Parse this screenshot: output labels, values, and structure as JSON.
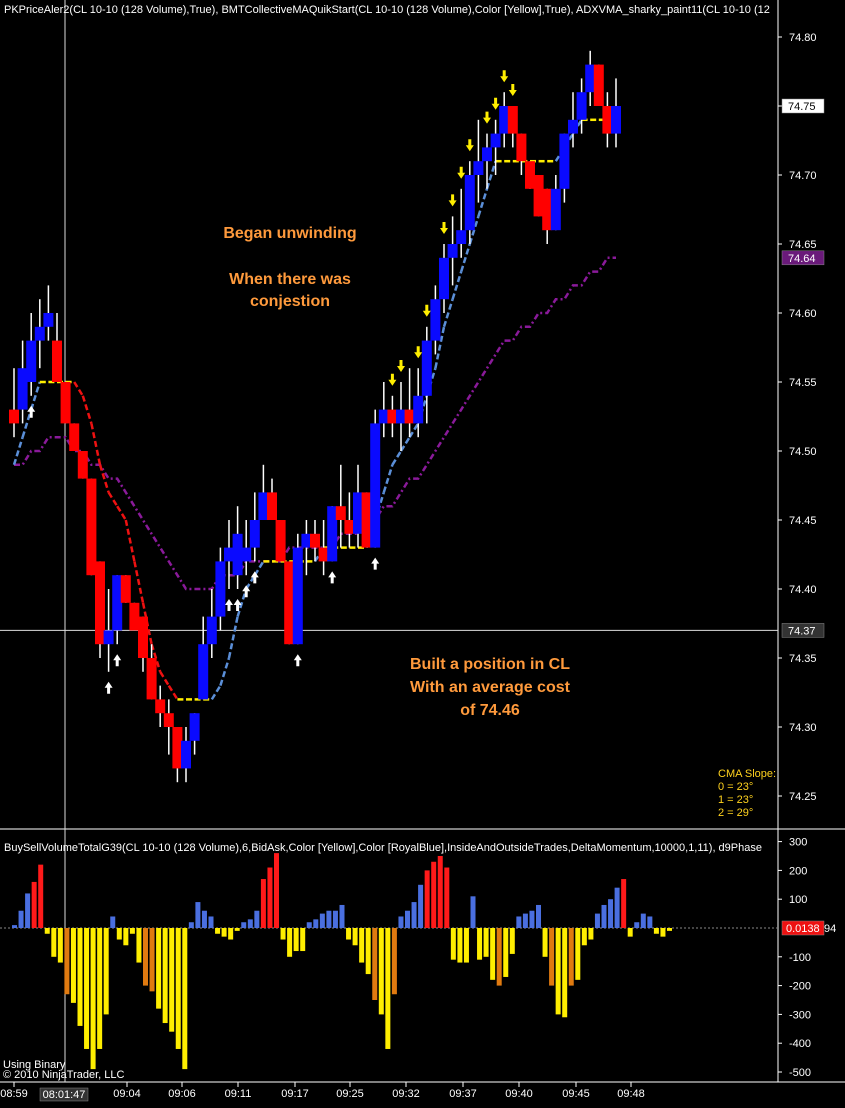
{
  "header": {
    "price_indicators": "PKPriceAler2(CL 10-10 (128 Volume),True), BMTCollectiveMAQuikStart(CL 10-10 (128 Volume),Color [Yellow],True), ADXVMA_sharky_paint11(CL 10-10 (12",
    "volume_indicators": "BuySellVolumeTotalG39(CL 10-10 (128 Volume),6,BidAsk,Color [Yellow],Color [RoyalBlue],InsideAndOutsideTrades,DeltaMomentum,10000,1,11), d9Phase"
  },
  "annotations": {
    "unwind_1": "Began unwinding",
    "unwind_2": "When there was",
    "unwind_3": "conjestion",
    "position_1": "Built a position in CL",
    "position_2": "With an average cost",
    "position_3": "of 74.46"
  },
  "cma_slope": {
    "title": "CMA Slope:",
    "line_0": "0 = 23°",
    "line_1": "1 = 23°",
    "line_2": "2 = 29°"
  },
  "footer": {
    "line1": "Using Binary",
    "line2": "© 2010 NinjaTrader, LLC"
  },
  "colors": {
    "up_bar": "#0a0aff",
    "down_bar": "#ff0000",
    "buy_volume": "#4a6fe0",
    "sell_volume": "#ffee00",
    "buy_volume_strong": "#ff1a1a",
    "sell_volume_strong": "#e07a10",
    "ma_fast": "#5b8fd8",
    "ma_slow": "#8a1a9a",
    "annotation": "#ff9a3c",
    "cma_label": "#ffd21e"
  },
  "chart_data": [
    {
      "type": "candlestick",
      "title": "",
      "price_axis": {
        "ticks": [
          "74.80",
          "74.75",
          "74.70",
          "74.65",
          "74.60",
          "74.55",
          "74.50",
          "74.45",
          "74.40",
          "74.35",
          "74.30",
          "74.25"
        ],
        "ylim": [
          74.22,
          74.82
        ]
      },
      "price_markers": {
        "last": "74.75",
        "ma": "74.64",
        "crosshair": "74.37"
      },
      "time_axis": {
        "ticks": [
          "08:59",
          "09:04",
          "09:06",
          "09:11",
          "09:17",
          "09:25",
          "09:32",
          "09:37",
          "09:40",
          "09:45",
          "09:48"
        ],
        "cursor_time": "08:01:47"
      },
      "candles": [
        {
          "o": 74.53,
          "h": 74.56,
          "l": 74.51,
          "c": 74.52
        },
        {
          "o": 74.53,
          "h": 74.58,
          "l": 74.52,
          "c": 74.56
        },
        {
          "o": 74.55,
          "h": 74.6,
          "l": 74.54,
          "c": 74.58
        },
        {
          "o": 74.58,
          "h": 74.61,
          "l": 74.56,
          "c": 74.59
        },
        {
          "o": 74.59,
          "h": 74.62,
          "l": 74.58,
          "c": 74.6
        },
        {
          "o": 74.58,
          "h": 74.6,
          "l": 74.55,
          "c": 74.55
        },
        {
          "o": 74.55,
          "h": 74.55,
          "l": 74.52,
          "c": 74.52
        },
        {
          "o": 74.52,
          "h": 74.52,
          "l": 74.5,
          "c": 74.5
        },
        {
          "o": 74.5,
          "h": 74.5,
          "l": 74.48,
          "c": 74.48
        },
        {
          "o": 74.48,
          "h": 74.48,
          "l": 74.41,
          "c": 74.41
        },
        {
          "o": 74.42,
          "h": 74.42,
          "l": 74.35,
          "c": 74.36
        },
        {
          "o": 74.36,
          "h": 74.4,
          "l": 74.34,
          "c": 74.37
        },
        {
          "o": 74.37,
          "h": 74.41,
          "l": 74.36,
          "c": 74.41
        },
        {
          "o": 74.41,
          "h": 74.41,
          "l": 74.39,
          "c": 74.39
        },
        {
          "o": 74.39,
          "h": 74.39,
          "l": 74.37,
          "c": 74.37
        },
        {
          "o": 74.38,
          "h": 74.38,
          "l": 74.34,
          "c": 74.35
        },
        {
          "o": 74.35,
          "h": 74.36,
          "l": 74.32,
          "c": 74.32
        },
        {
          "o": 74.32,
          "h": 74.33,
          "l": 74.3,
          "c": 74.31
        },
        {
          "o": 74.31,
          "h": 74.32,
          "l": 74.28,
          "c": 74.3
        },
        {
          "o": 74.3,
          "h": 74.3,
          "l": 74.26,
          "c": 74.27
        },
        {
          "o": 74.27,
          "h": 74.3,
          "l": 74.26,
          "c": 74.29
        },
        {
          "o": 74.29,
          "h": 74.31,
          "l": 74.28,
          "c": 74.31
        },
        {
          "o": 74.32,
          "h": 74.38,
          "l": 74.32,
          "c": 74.36
        },
        {
          "o": 74.36,
          "h": 74.4,
          "l": 74.35,
          "c": 74.38
        },
        {
          "o": 74.38,
          "h": 74.43,
          "l": 74.37,
          "c": 74.42
        },
        {
          "o": 74.42,
          "h": 74.45,
          "l": 74.4,
          "c": 74.43
        },
        {
          "o": 74.41,
          "h": 74.46,
          "l": 74.4,
          "c": 74.44
        },
        {
          "o": 74.42,
          "h": 74.45,
          "l": 74.41,
          "c": 74.43
        },
        {
          "o": 74.43,
          "h": 74.47,
          "l": 74.42,
          "c": 74.45
        },
        {
          "o": 74.45,
          "h": 74.49,
          "l": 74.45,
          "c": 74.47
        },
        {
          "o": 74.47,
          "h": 74.48,
          "l": 74.45,
          "c": 74.45
        },
        {
          "o": 74.45,
          "h": 74.45,
          "l": 74.42,
          "c": 74.42
        },
        {
          "o": 74.42,
          "h": 74.42,
          "l": 74.36,
          "c": 74.36
        },
        {
          "o": 74.36,
          "h": 74.44,
          "l": 74.36,
          "c": 74.43
        },
        {
          "o": 74.43,
          "h": 74.45,
          "l": 74.41,
          "c": 74.44
        },
        {
          "o": 74.44,
          "h": 74.45,
          "l": 74.42,
          "c": 74.43
        },
        {
          "o": 74.43,
          "h": 74.45,
          "l": 74.41,
          "c": 74.42
        },
        {
          "o": 74.42,
          "h": 74.46,
          "l": 74.42,
          "c": 74.46
        },
        {
          "o": 74.46,
          "h": 74.49,
          "l": 74.43,
          "c": 74.45
        },
        {
          "o": 74.45,
          "h": 74.47,
          "l": 74.43,
          "c": 74.44
        },
        {
          "o": 74.44,
          "h": 74.49,
          "l": 74.43,
          "c": 74.47
        },
        {
          "o": 74.47,
          "h": 74.47,
          "l": 74.43,
          "c": 74.43
        },
        {
          "o": 74.43,
          "h": 74.53,
          "l": 74.43,
          "c": 74.52
        },
        {
          "o": 74.52,
          "h": 74.55,
          "l": 74.51,
          "c": 74.53
        },
        {
          "o": 74.53,
          "h": 74.54,
          "l": 74.51,
          "c": 74.52
        },
        {
          "o": 74.52,
          "h": 74.55,
          "l": 74.5,
          "c": 74.53
        },
        {
          "o": 74.53,
          "h": 74.56,
          "l": 74.51,
          "c": 74.52
        },
        {
          "o": 74.52,
          "h": 74.56,
          "l": 74.51,
          "c": 74.54
        },
        {
          "o": 74.54,
          "h": 74.59,
          "l": 74.52,
          "c": 74.58
        },
        {
          "o": 74.58,
          "h": 74.62,
          "l": 74.57,
          "c": 74.61
        },
        {
          "o": 74.61,
          "h": 74.65,
          "l": 74.6,
          "c": 74.64
        },
        {
          "o": 74.64,
          "h": 74.67,
          "l": 74.62,
          "c": 74.65
        },
        {
          "o": 74.65,
          "h": 74.69,
          "l": 74.64,
          "c": 74.66
        },
        {
          "o": 74.66,
          "h": 74.71,
          "l": 74.65,
          "c": 74.7
        },
        {
          "o": 74.7,
          "h": 74.74,
          "l": 74.68,
          "c": 74.71
        },
        {
          "o": 74.71,
          "h": 74.73,
          "l": 74.69,
          "c": 74.72
        },
        {
          "o": 74.72,
          "h": 74.74,
          "l": 74.7,
          "c": 74.73
        },
        {
          "o": 74.73,
          "h": 74.76,
          "l": 74.72,
          "c": 74.75
        },
        {
          "o": 74.75,
          "h": 74.75,
          "l": 74.72,
          "c": 74.73
        },
        {
          "o": 74.73,
          "h": 74.73,
          "l": 74.7,
          "c": 74.71
        },
        {
          "o": 74.71,
          "h": 74.71,
          "l": 74.69,
          "c": 74.69
        },
        {
          "o": 74.7,
          "h": 74.7,
          "l": 74.67,
          "c": 74.67
        },
        {
          "o": 74.69,
          "h": 74.69,
          "l": 74.65,
          "c": 74.66
        },
        {
          "o": 74.66,
          "h": 74.7,
          "l": 74.66,
          "c": 74.69
        },
        {
          "o": 74.69,
          "h": 74.73,
          "l": 74.68,
          "c": 74.73
        },
        {
          "o": 74.73,
          "h": 74.76,
          "l": 74.72,
          "c": 74.74
        },
        {
          "o": 74.74,
          "h": 74.77,
          "l": 74.73,
          "c": 74.76
        },
        {
          "o": 74.76,
          "h": 74.79,
          "l": 74.75,
          "c": 74.78
        },
        {
          "o": 74.78,
          "h": 74.78,
          "l": 74.75,
          "c": 74.75
        },
        {
          "o": 74.75,
          "h": 74.76,
          "l": 74.72,
          "c": 74.73
        },
        {
          "o": 74.73,
          "h": 74.77,
          "l": 74.72,
          "c": 74.75
        }
      ],
      "ma_fast": [
        74.49,
        74.51,
        74.53,
        74.55,
        74.55,
        74.55,
        74.55,
        74.55,
        74.54,
        74.52,
        74.49,
        74.47,
        74.46,
        74.45,
        74.42,
        74.39,
        74.36,
        74.34,
        74.33,
        74.32,
        74.32,
        74.32,
        74.32,
        74.32,
        74.33,
        74.35,
        74.38,
        74.4,
        74.41,
        74.42,
        74.42,
        74.42,
        74.42,
        74.42,
        74.42,
        74.42,
        74.43,
        74.43,
        74.43,
        74.43,
        74.43,
        74.43,
        74.45,
        74.47,
        74.49,
        74.5,
        74.51,
        74.52,
        74.54,
        74.56,
        74.59,
        74.61,
        74.63,
        74.65,
        74.67,
        74.69,
        74.71,
        74.71,
        74.71,
        74.71,
        74.71,
        74.71,
        74.71,
        74.71,
        74.72,
        74.73,
        74.74,
        74.74,
        74.74,
        74.74,
        74.74
      ],
      "ma_slow": [
        74.49,
        74.49,
        74.5,
        74.5,
        74.51,
        74.51,
        74.51,
        74.5,
        74.5,
        74.49,
        74.49,
        74.48,
        74.48,
        74.47,
        74.46,
        74.45,
        74.44,
        74.43,
        74.42,
        74.41,
        74.4,
        74.4,
        74.4,
        74.4,
        74.41,
        74.41,
        74.41,
        74.42,
        74.42,
        74.42,
        74.42,
        74.42,
        74.43,
        74.43,
        74.43,
        74.43,
        74.43,
        74.43,
        74.44,
        74.44,
        74.44,
        74.45,
        74.45,
        74.46,
        74.46,
        74.47,
        74.48,
        74.48,
        74.49,
        74.5,
        74.51,
        74.52,
        74.53,
        74.54,
        74.55,
        74.56,
        74.57,
        74.58,
        74.58,
        74.59,
        74.59,
        74.6,
        74.6,
        74.61,
        74.61,
        74.62,
        74.62,
        74.63,
        74.63,
        74.64,
        74.64
      ]
    },
    {
      "type": "bar",
      "title": "",
      "volume_axis": {
        "ticks": [
          "300",
          "200",
          "100",
          "-100",
          "-200",
          "-300",
          "-400",
          "-500"
        ],
        "ylim": [
          -520,
          310
        ]
      },
      "volume_marker": "0.0138",
      "volume_marker_overflow": "94",
      "values": [
        10,
        60,
        120,
        160,
        220,
        -20,
        -100,
        -120,
        -230,
        -260,
        -340,
        -420,
        -490,
        -420,
        -300,
        40,
        -40,
        -60,
        -20,
        -120,
        -200,
        -220,
        -280,
        -330,
        -360,
        -420,
        -490,
        20,
        90,
        60,
        40,
        -20,
        -30,
        -40,
        -10,
        20,
        30,
        60,
        170,
        210,
        260,
        -40,
        -100,
        -80,
        -80,
        20,
        30,
        50,
        60,
        60,
        80,
        -40,
        -60,
        -120,
        -160,
        -250,
        -300,
        -420,
        -230,
        40,
        60,
        90,
        150,
        200,
        230,
        250,
        210,
        -110,
        -120,
        -120,
        110,
        -110,
        -100,
        -180,
        -200,
        -170,
        -90,
        40,
        50,
        60,
        80,
        -100,
        -200,
        -300,
        -310,
        -200,
        -180,
        -60,
        -40,
        50,
        80,
        100,
        140,
        170,
        -30,
        20,
        50,
        40,
        -20,
        -30,
        -10
      ]
    }
  ]
}
